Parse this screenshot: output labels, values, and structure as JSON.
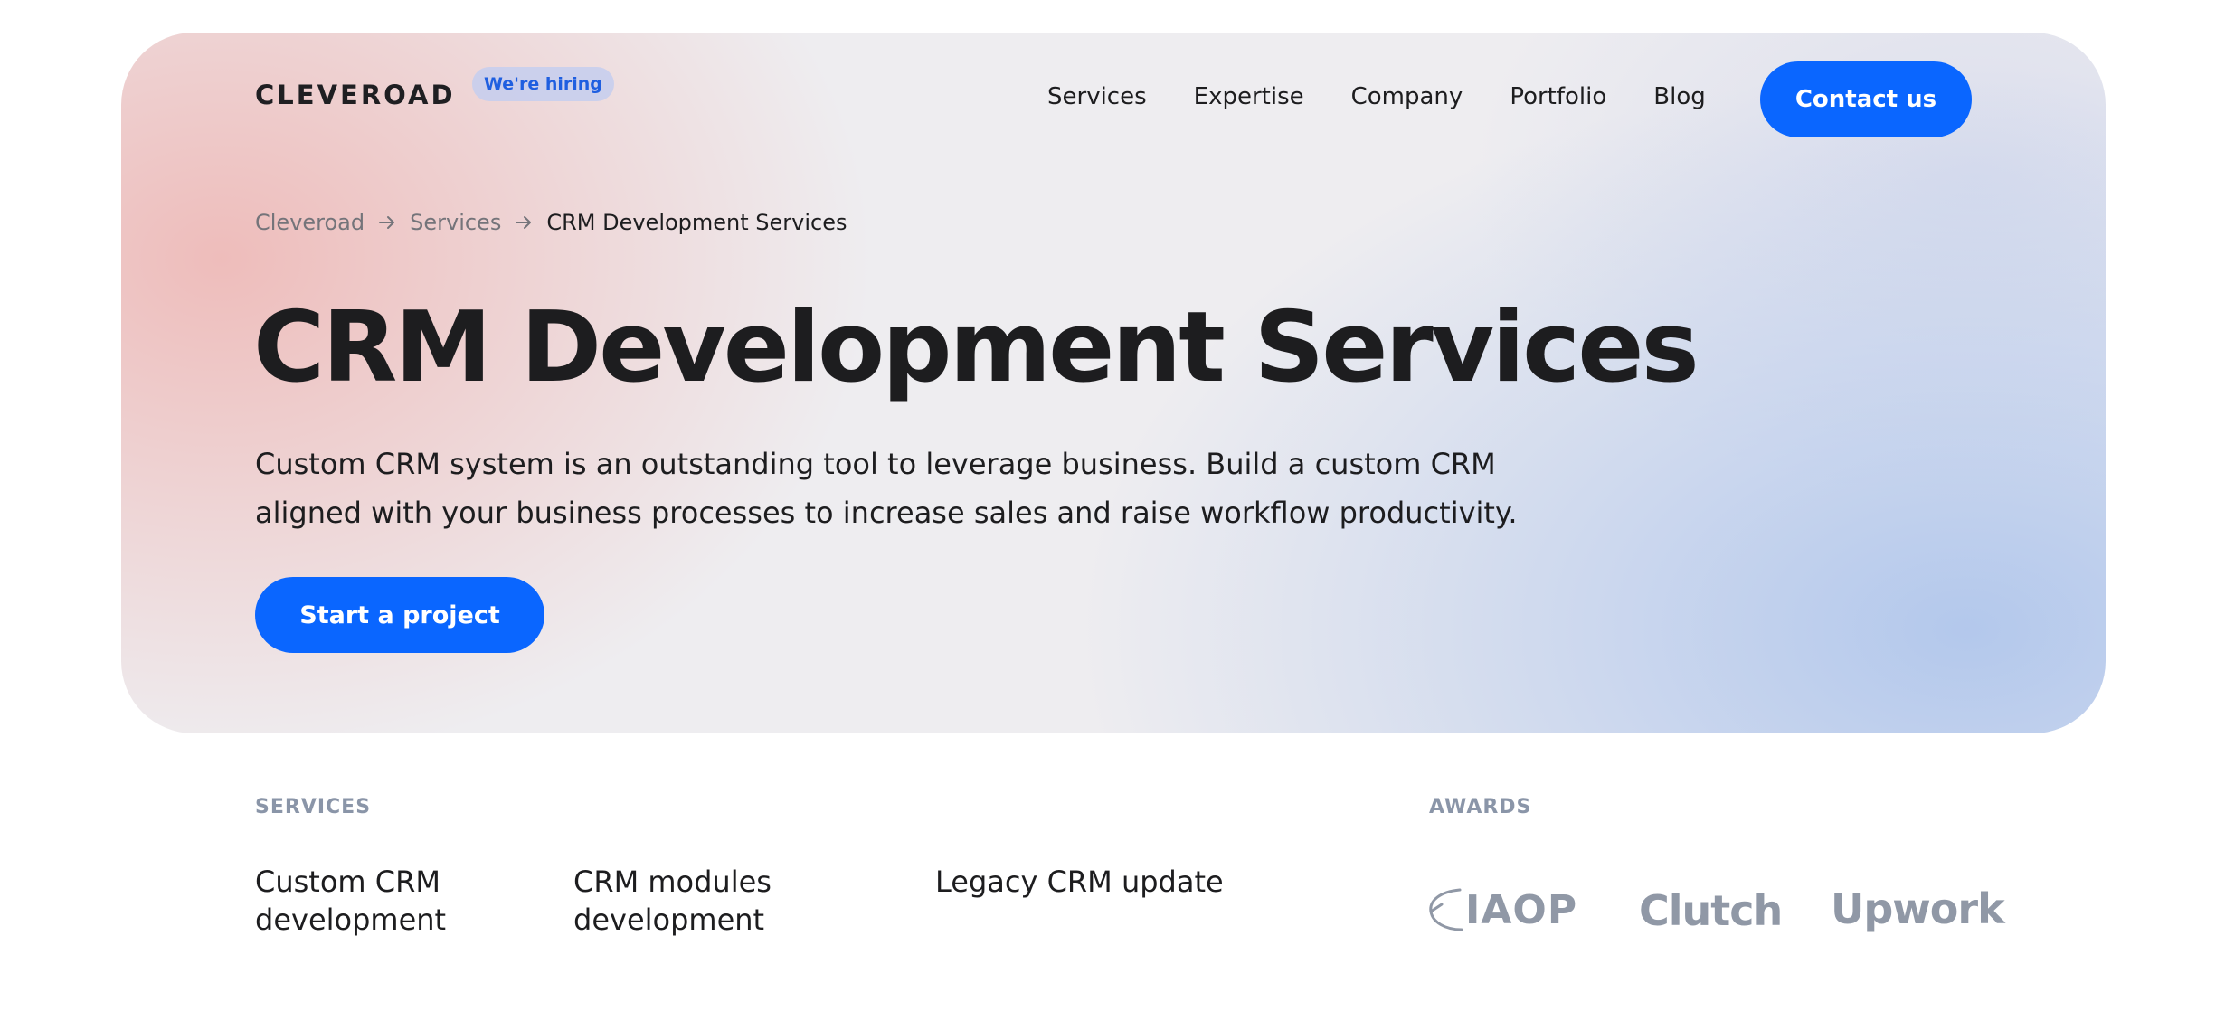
{
  "header": {
    "logo": "CLEVEROAD",
    "hiring_badge": "We're hiring",
    "nav": [
      "Services",
      "Expertise",
      "Company",
      "Portfolio",
      "Blog"
    ],
    "contact_button": "Contact us"
  },
  "breadcrumb": {
    "items": [
      "Cleveroad",
      "Services",
      "CRM Development Services"
    ],
    "separator_icon": "arrow-right-icon"
  },
  "hero": {
    "title": "CRM Development Services",
    "subtitle": "Custom CRM system is an outstanding tool to leverage business. Build a custom CRM aligned with your business processes to increase sales and raise workflow productivity.",
    "cta_button": "Start a project"
  },
  "services": {
    "label": "SERVICES",
    "items": [
      "Custom CRM development",
      "CRM modules development",
      "Legacy CRM update"
    ]
  },
  "awards": {
    "label": "AWARDS",
    "logos": [
      "IAOP",
      "Clutch",
      "Upwork"
    ]
  },
  "colors": {
    "accent": "#0a66ff",
    "text": "#1d1d1f",
    "muted": "#8a95a8"
  }
}
